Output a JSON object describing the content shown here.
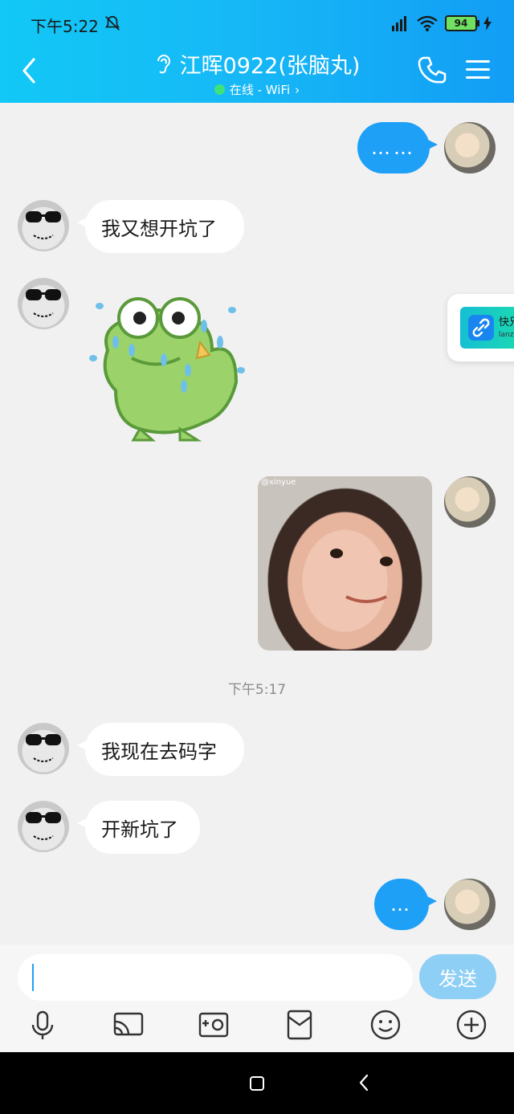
{
  "status_bar": {
    "time": "下午5:22",
    "battery": "94"
  },
  "header": {
    "title": "江晖0922(张脑丸)",
    "subtitle": "在线 - WiFi",
    "online_color": "#3fe27a"
  },
  "messages": [
    {
      "sender": "me",
      "type": "text",
      "text": "……"
    },
    {
      "sender": "other",
      "type": "text",
      "text": "我又想开坑了"
    },
    {
      "sender": "other",
      "type": "sticker",
      "icon": "crying-frog-sticker"
    },
    {
      "sender": "me",
      "type": "photo",
      "icon": "baby-photo",
      "watermark": "@xinyue"
    },
    {
      "sender": "system",
      "type": "timestamp",
      "text": "下午5:17"
    },
    {
      "sender": "other",
      "type": "text",
      "text": "我现在去码字"
    },
    {
      "sender": "other",
      "type": "text",
      "text": "开新坑了"
    },
    {
      "sender": "me",
      "type": "text",
      "text": "…"
    }
  ],
  "floating_card": {
    "title": "快兄",
    "subtitle": "lanz"
  },
  "input": {
    "value": "",
    "send_label": "发送"
  },
  "toolbar": [
    "microphone-icon",
    "screen-share-icon",
    "photo-icon",
    "red-packet-icon",
    "emoji-icon",
    "plus-icon"
  ],
  "colors": {
    "header_gradient_start": "#12c8f6",
    "header_gradient_end": "#129df5",
    "bubble_blue": "#1ea0f7",
    "send_button": "#8ecff6"
  }
}
